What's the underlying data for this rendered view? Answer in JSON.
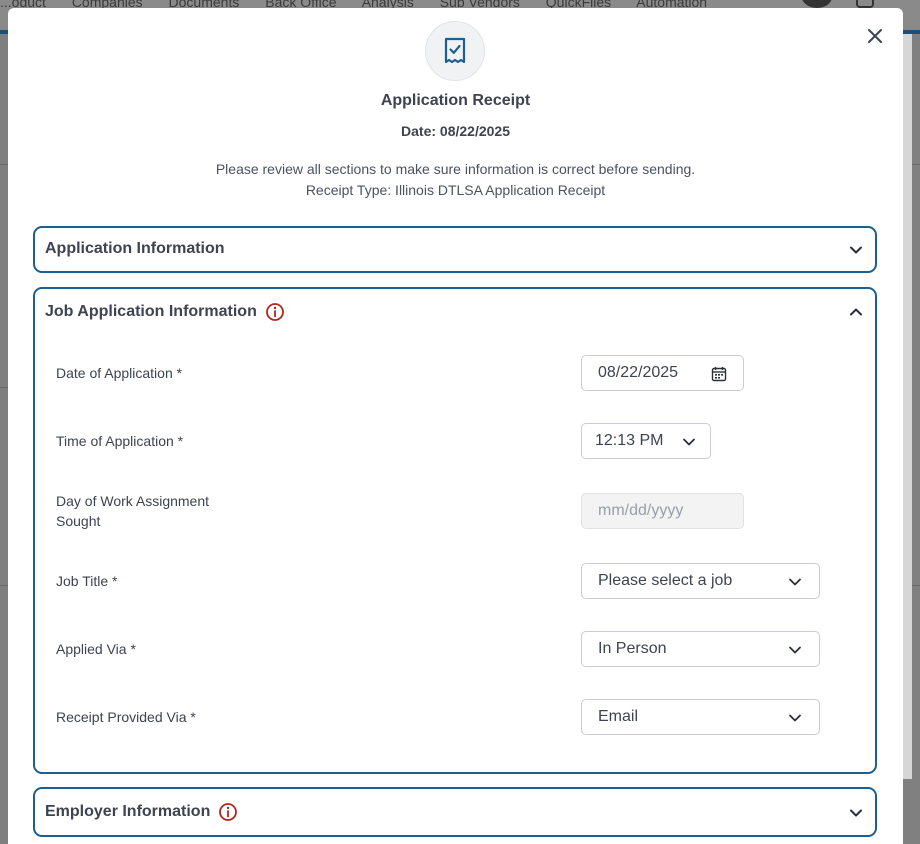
{
  "background": {
    "menu": [
      "...oduct",
      "Companies",
      "Documents",
      "Back Office",
      "Analysis",
      "Sub Vendors",
      "QuickFiles",
      "Automation"
    ]
  },
  "modal": {
    "header_icon": "receipt-check-icon",
    "title": "Application Receipt",
    "date": "Date: 08/22/2025",
    "note_line1": "Please review all sections to make sure information is correct before sending.",
    "note_line2": "Receipt Type: Illinois DTLSA Application Receipt",
    "close_icon": "close-icon"
  },
  "sections": {
    "application_info": {
      "title": "Application Information",
      "expanded": false
    },
    "job_application_info": {
      "title": "Job Application Information",
      "expanded": true,
      "has_warning": true,
      "fields": {
        "date_of_application": {
          "label": "Date of Application *",
          "value": "08/22/2025"
        },
        "time_of_application": {
          "label": "Time of Application *",
          "value": "12:13 PM"
        },
        "day_of_work": {
          "label_line1": "Day of Work Assignment",
          "label_line2": "Sought",
          "placeholder": "mm/dd/yyyy"
        },
        "job_title": {
          "label": "Job Title *",
          "value": "Please select a job"
        },
        "applied_via": {
          "label": "Applied Via *",
          "value": "In Person"
        },
        "receipt_provided_via": {
          "label": "Receipt Provided Via *",
          "value": "Email"
        }
      }
    },
    "employer_info": {
      "title": "Employer Information",
      "expanded": false,
      "has_warning": true
    }
  },
  "colors": {
    "accent": "#1d5f8e",
    "warning": "#b3261e",
    "text": "#3d4350"
  }
}
